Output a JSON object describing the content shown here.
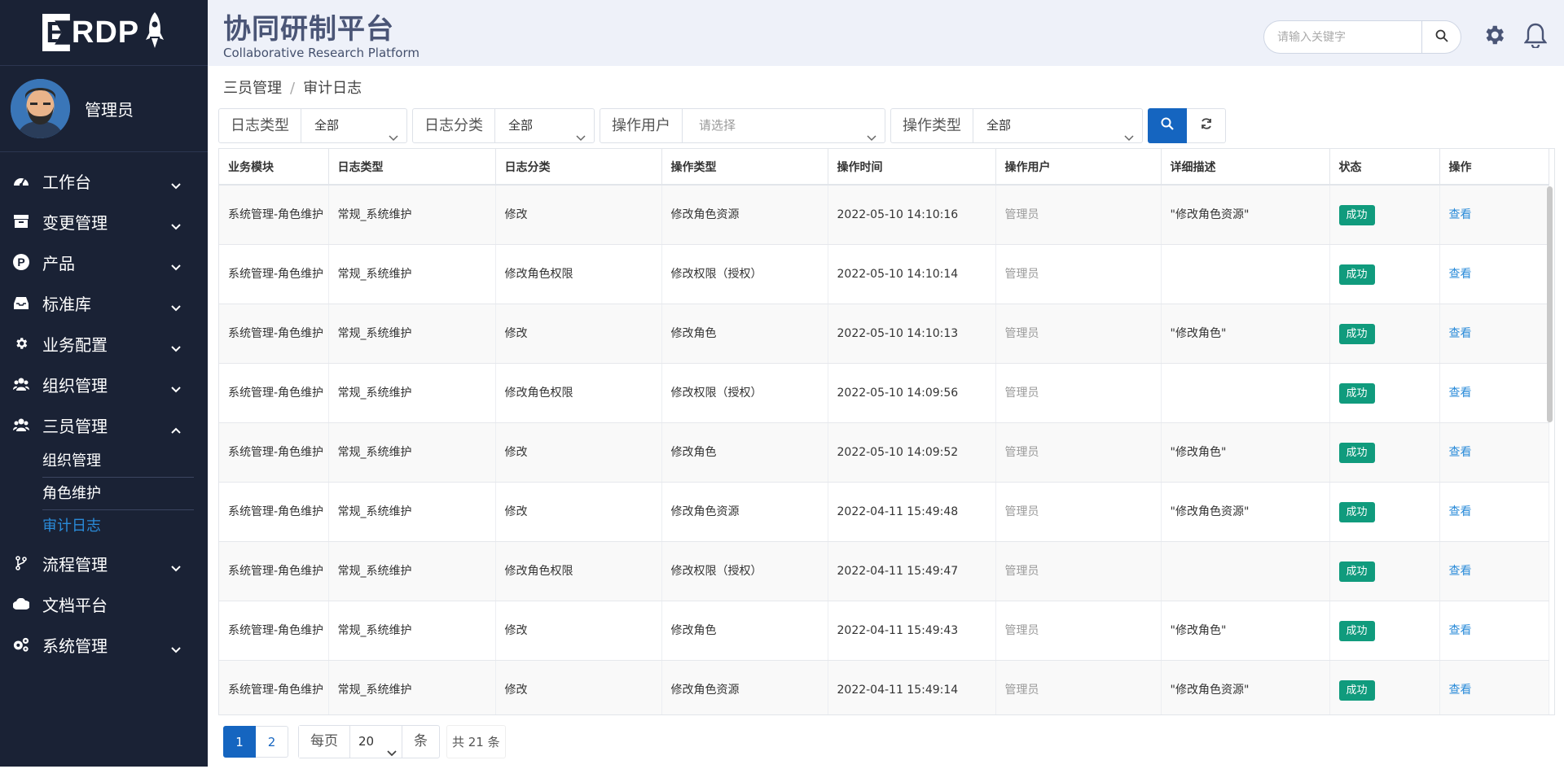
{
  "brand": {
    "logo_text": "RDP",
    "logo_letter": "E"
  },
  "user": {
    "name": "管理员"
  },
  "sidebar": {
    "items": [
      {
        "label": "工作台",
        "icon": "dashboard-icon"
      },
      {
        "label": "变更管理",
        "icon": "archive-icon"
      },
      {
        "label": "产品",
        "icon": "product-p-icon"
      },
      {
        "label": "标准库",
        "icon": "inbox-icon"
      },
      {
        "label": "业务配置",
        "icon": "gear-icon"
      },
      {
        "label": "组织管理",
        "icon": "users-icon"
      },
      {
        "label": "三员管理",
        "icon": "users-icon"
      },
      {
        "label": "流程管理",
        "icon": "branch-icon"
      },
      {
        "label": "文档平台",
        "icon": "cloud-icon"
      },
      {
        "label": "系统管理",
        "icon": "cogs-icon"
      }
    ],
    "submenu": [
      {
        "label": "组织管理",
        "active": false
      },
      {
        "label": "角色维护",
        "active": false
      },
      {
        "label": "审计日志",
        "active": true
      }
    ]
  },
  "header": {
    "title": "协同研制平台",
    "subtitle": "Collaborative Research Platform",
    "search_placeholder": "请输入关键字"
  },
  "breadcrumb": {
    "parent": "三员管理",
    "separator": "/",
    "current": "审计日志"
  },
  "filters": {
    "log_type": {
      "label": "日志类型",
      "value": "全部"
    },
    "log_category": {
      "label": "日志分类",
      "value": "全部"
    },
    "operator": {
      "label": "操作用户",
      "placeholder": "请选择"
    },
    "op_type": {
      "label": "操作类型",
      "value": "全部"
    }
  },
  "table": {
    "headers": [
      "业务模块",
      "日志类型",
      "日志分类",
      "操作类型",
      "操作时间",
      "操作用户",
      "详细描述",
      "状态",
      "操作"
    ],
    "rows": [
      [
        "系统管理-角色维护",
        "常规_系统维护",
        "修改",
        "修改角色资源",
        "2022-05-10 14:10:16",
        "管理员",
        "\"修改角色资源\"",
        "成功",
        "查看"
      ],
      [
        "系统管理-角色维护",
        "常规_系统维护",
        "修改角色权限",
        "修改权限（授权）",
        "2022-05-10 14:10:14",
        "管理员",
        "",
        "成功",
        "查看"
      ],
      [
        "系统管理-角色维护",
        "常规_系统维护",
        "修改",
        "修改角色",
        "2022-05-10 14:10:13",
        "管理员",
        "\"修改角色\"",
        "成功",
        "查看"
      ],
      [
        "系统管理-角色维护",
        "常规_系统维护",
        "修改角色权限",
        "修改权限（授权）",
        "2022-05-10 14:09:56",
        "管理员",
        "",
        "成功",
        "查看"
      ],
      [
        "系统管理-角色维护",
        "常规_系统维护",
        "修改",
        "修改角色",
        "2022-05-10 14:09:52",
        "管理员",
        "\"修改角色\"",
        "成功",
        "查看"
      ],
      [
        "系统管理-角色维护",
        "常规_系统维护",
        "修改",
        "修改角色资源",
        "2022-04-11 15:49:48",
        "管理员",
        "\"修改角色资源\"",
        "成功",
        "查看"
      ],
      [
        "系统管理-角色维护",
        "常规_系统维护",
        "修改角色权限",
        "修改权限（授权）",
        "2022-04-11 15:49:47",
        "管理员",
        "",
        "成功",
        "查看"
      ],
      [
        "系统管理-角色维护",
        "常规_系统维护",
        "修改",
        "修改角色",
        "2022-04-11 15:49:43",
        "管理员",
        "\"修改角色\"",
        "成功",
        "查看"
      ],
      [
        "系统管理-角色维护",
        "常规_系统维护",
        "修改",
        "修改角色资源",
        "2022-04-11 15:49:14",
        "管理员",
        "\"修改角色资源\"",
        "成功",
        "查看"
      ]
    ]
  },
  "pagination": {
    "pages": [
      "1",
      "2"
    ],
    "current": "1",
    "per_page_label": "每页",
    "per_page_value": "20",
    "per_page_unit": "条",
    "total_text": "共 21 条"
  },
  "colors": {
    "sidebar_bg": "#1a2235",
    "accent": "#1565c0",
    "success": "#109b7d",
    "link": "#2a8bd9",
    "header_bg": "#eef1f9"
  }
}
